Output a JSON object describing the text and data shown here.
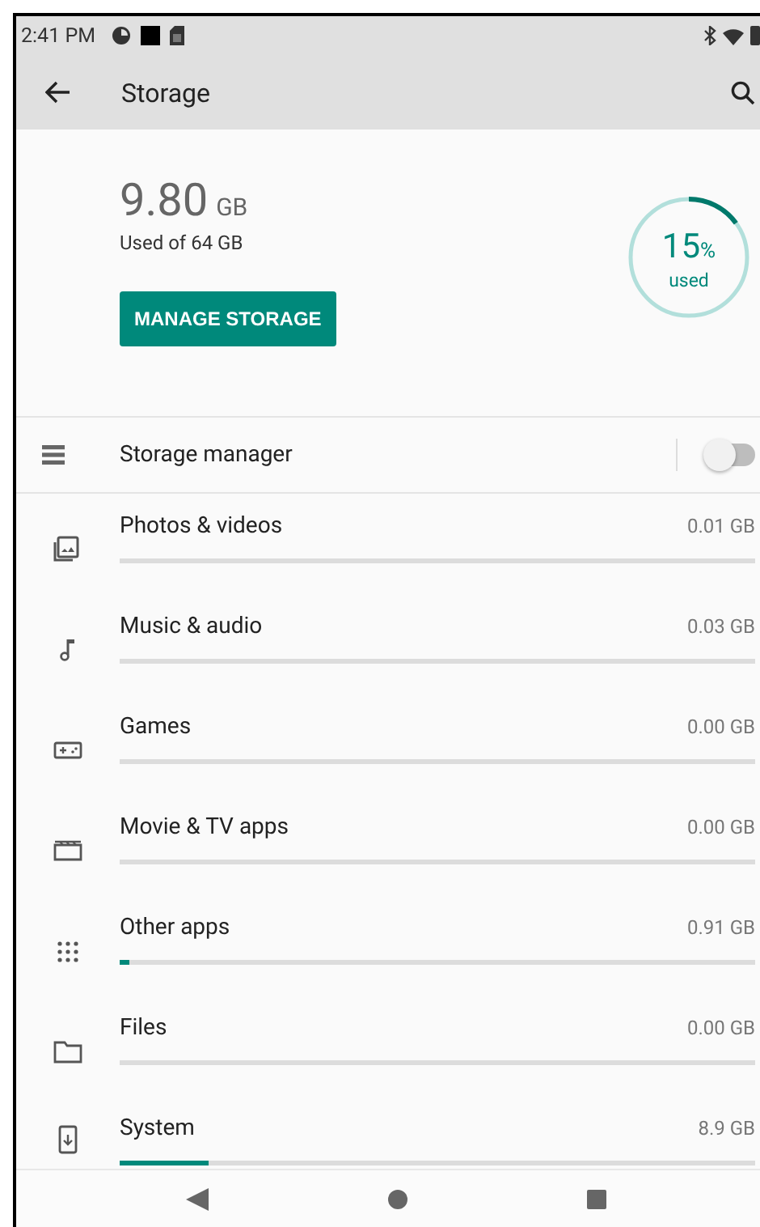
{
  "status_bar": {
    "time": "2:41 PM"
  },
  "toolbar": {
    "title": "Storage"
  },
  "summary": {
    "amount": "9.80",
    "unit": "GB",
    "caption": "Used of 64 GB",
    "button": "MANAGE STORAGE",
    "percent": "15",
    "percent_sign": "%",
    "percent_caption": "used",
    "level": 0.15
  },
  "storage_manager": {
    "label": "Storage manager",
    "on": false
  },
  "categories": [
    {
      "kind": "photos",
      "label": "Photos & videos",
      "size": "0.01 GB",
      "level": 0
    },
    {
      "kind": "music",
      "label": "Music & audio",
      "size": "0.03 GB",
      "level": 0
    },
    {
      "kind": "games",
      "label": "Games",
      "size": "0.00 GB",
      "level": 0
    },
    {
      "kind": "movies",
      "label": "Movie & TV apps",
      "size": "0.00 GB",
      "level": 0
    },
    {
      "kind": "apps",
      "label": "Other apps",
      "size": "0.91 GB",
      "level": 0.014
    },
    {
      "kind": "files",
      "label": "Files",
      "size": "0.00 GB",
      "level": 0
    },
    {
      "kind": "system",
      "label": "System",
      "size": "8.9 GB",
      "level": 0.14
    }
  ]
}
